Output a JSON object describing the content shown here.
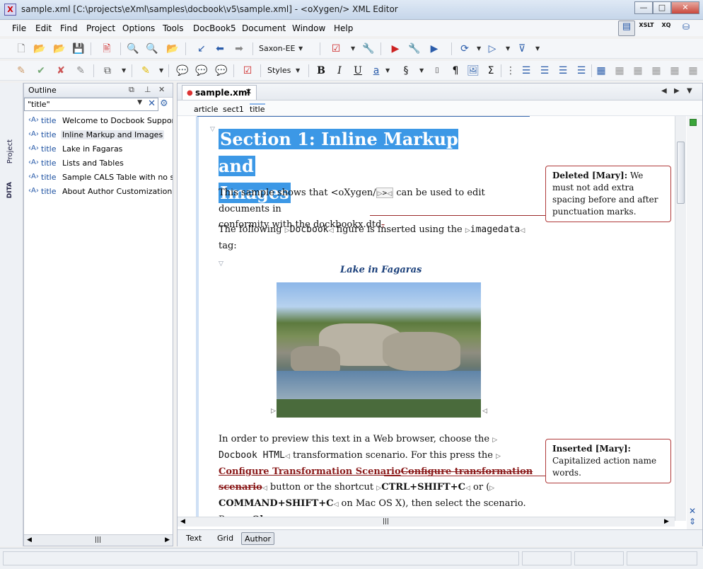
{
  "window": {
    "title": "sample.xml [C:\\projects\\eXml\\samples\\docbook\\v5\\sample.xml] - <oXygen/> XML Editor",
    "app_icon_glyph": "X",
    "controls": {
      "minimize": "—",
      "maximize": "□",
      "close": "✕"
    }
  },
  "menubar": [
    "File",
    "Edit",
    "Find",
    "Project",
    "Options",
    "Tools",
    "DocBook5",
    "Document",
    "Window",
    "Help"
  ],
  "toolbar1": {
    "transformer": "Saxon-EE",
    "perspectives": [
      "editor-perspective-icon",
      "xslt-debugger-icon",
      "xquery-debugger-icon",
      "database-icon"
    ],
    "perspective_labels": {
      "xslt": "XSLT",
      "xquery": "XQ"
    }
  },
  "toolbar2": {
    "styles_label": "Styles",
    "format_buttons": [
      "B",
      "I",
      "U",
      "a",
      "§",
      "¶",
      "Σ"
    ]
  },
  "side_tabs": [
    "Project",
    "DITA"
  ],
  "outline": {
    "title": "Outline",
    "filter_value": "\"title\"",
    "items": [
      {
        "tag": "title",
        "text": "Welcome to Docbook Support in o",
        "selected": false
      },
      {
        "tag": "title",
        "text": "Inline Markup and Images",
        "selected": true
      },
      {
        "tag": "title",
        "text": "Lake in Fagaras",
        "selected": false
      },
      {
        "tag": "title",
        "text": "Lists and Tables",
        "selected": false
      },
      {
        "tag": "title",
        "text": "Sample CALS Table with no speci",
        "selected": false
      },
      {
        "tag": "title",
        "text": "About Author Customization",
        "selected": false
      }
    ]
  },
  "editor": {
    "tab_label": "sample.xml",
    "breadcrumb": [
      "article",
      "sect1",
      "title"
    ],
    "heading": {
      "line1": "Section 1: Inline Markup and",
      "line2": "Images"
    },
    "para1": {
      "part1": "This sample shows that <oXygen/",
      "tag": ">",
      "part2": " can be used to edit documents in",
      "line2": "conformity with the dockbookx.dtd",
      "deleted_char": "."
    },
    "para2": {
      "part1": "The following ",
      "code1": "Docbook",
      "part2": " figure is inserted using the ",
      "code2": "imagedata",
      "line2": " tag:"
    },
    "figure_title": "Lake in Fagaras",
    "para3": {
      "line1": "In order to preview this text in a Web browser, choose the",
      "code1": "Docbook HTML",
      "line2_rest": " transformation scenario. For this press the",
      "inserted": "Configure Transformation Scenario",
      "deleted_a": "Configure transformation",
      "deleted_b": "scenario",
      "line4_rest": " button or the shortcut ",
      "shortcut1": "CTRL+SHIFT+C",
      "or_text": " or (",
      "shortcut2": "COMMAND+SHIFT+C",
      "mac_text": " on Mac OS X), then select the scenario.",
      "press_text": "Press ",
      "ok_text": "Ok"
    },
    "comments": [
      {
        "author": "Deleted [Mary]:",
        "text": "We must not add extra spacing before and after punctuation marks."
      },
      {
        "author": "Inserted [Mary]:",
        "text": "Capitalized action name words."
      }
    ],
    "modes": [
      "Text",
      "Grid",
      "Author"
    ],
    "active_mode": "Author"
  }
}
